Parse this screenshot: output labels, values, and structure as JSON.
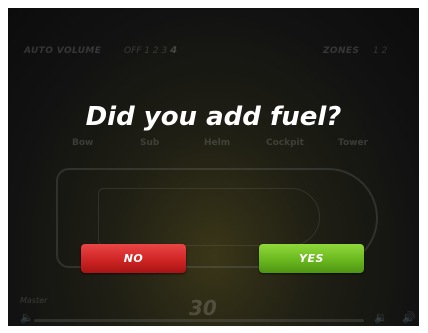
{
  "header": {
    "auto_volume_label": "AUTO VOLUME",
    "auto_volume_levels": "OFF 1 2 3",
    "auto_volume_current": "4",
    "zones_label": "ZONES",
    "zones_value": "1 2"
  },
  "zones": [
    "Bow",
    "Sub",
    "Helm",
    "Cockpit",
    "Tower"
  ],
  "master": {
    "label": "Master",
    "volume": "30"
  },
  "dialog": {
    "prompt": "Did you add fuel?",
    "no_label": "NO",
    "yes_label": "YES"
  },
  "colors": {
    "no_button": "#d42b2b",
    "yes_button": "#74c226",
    "background": "#121212"
  }
}
